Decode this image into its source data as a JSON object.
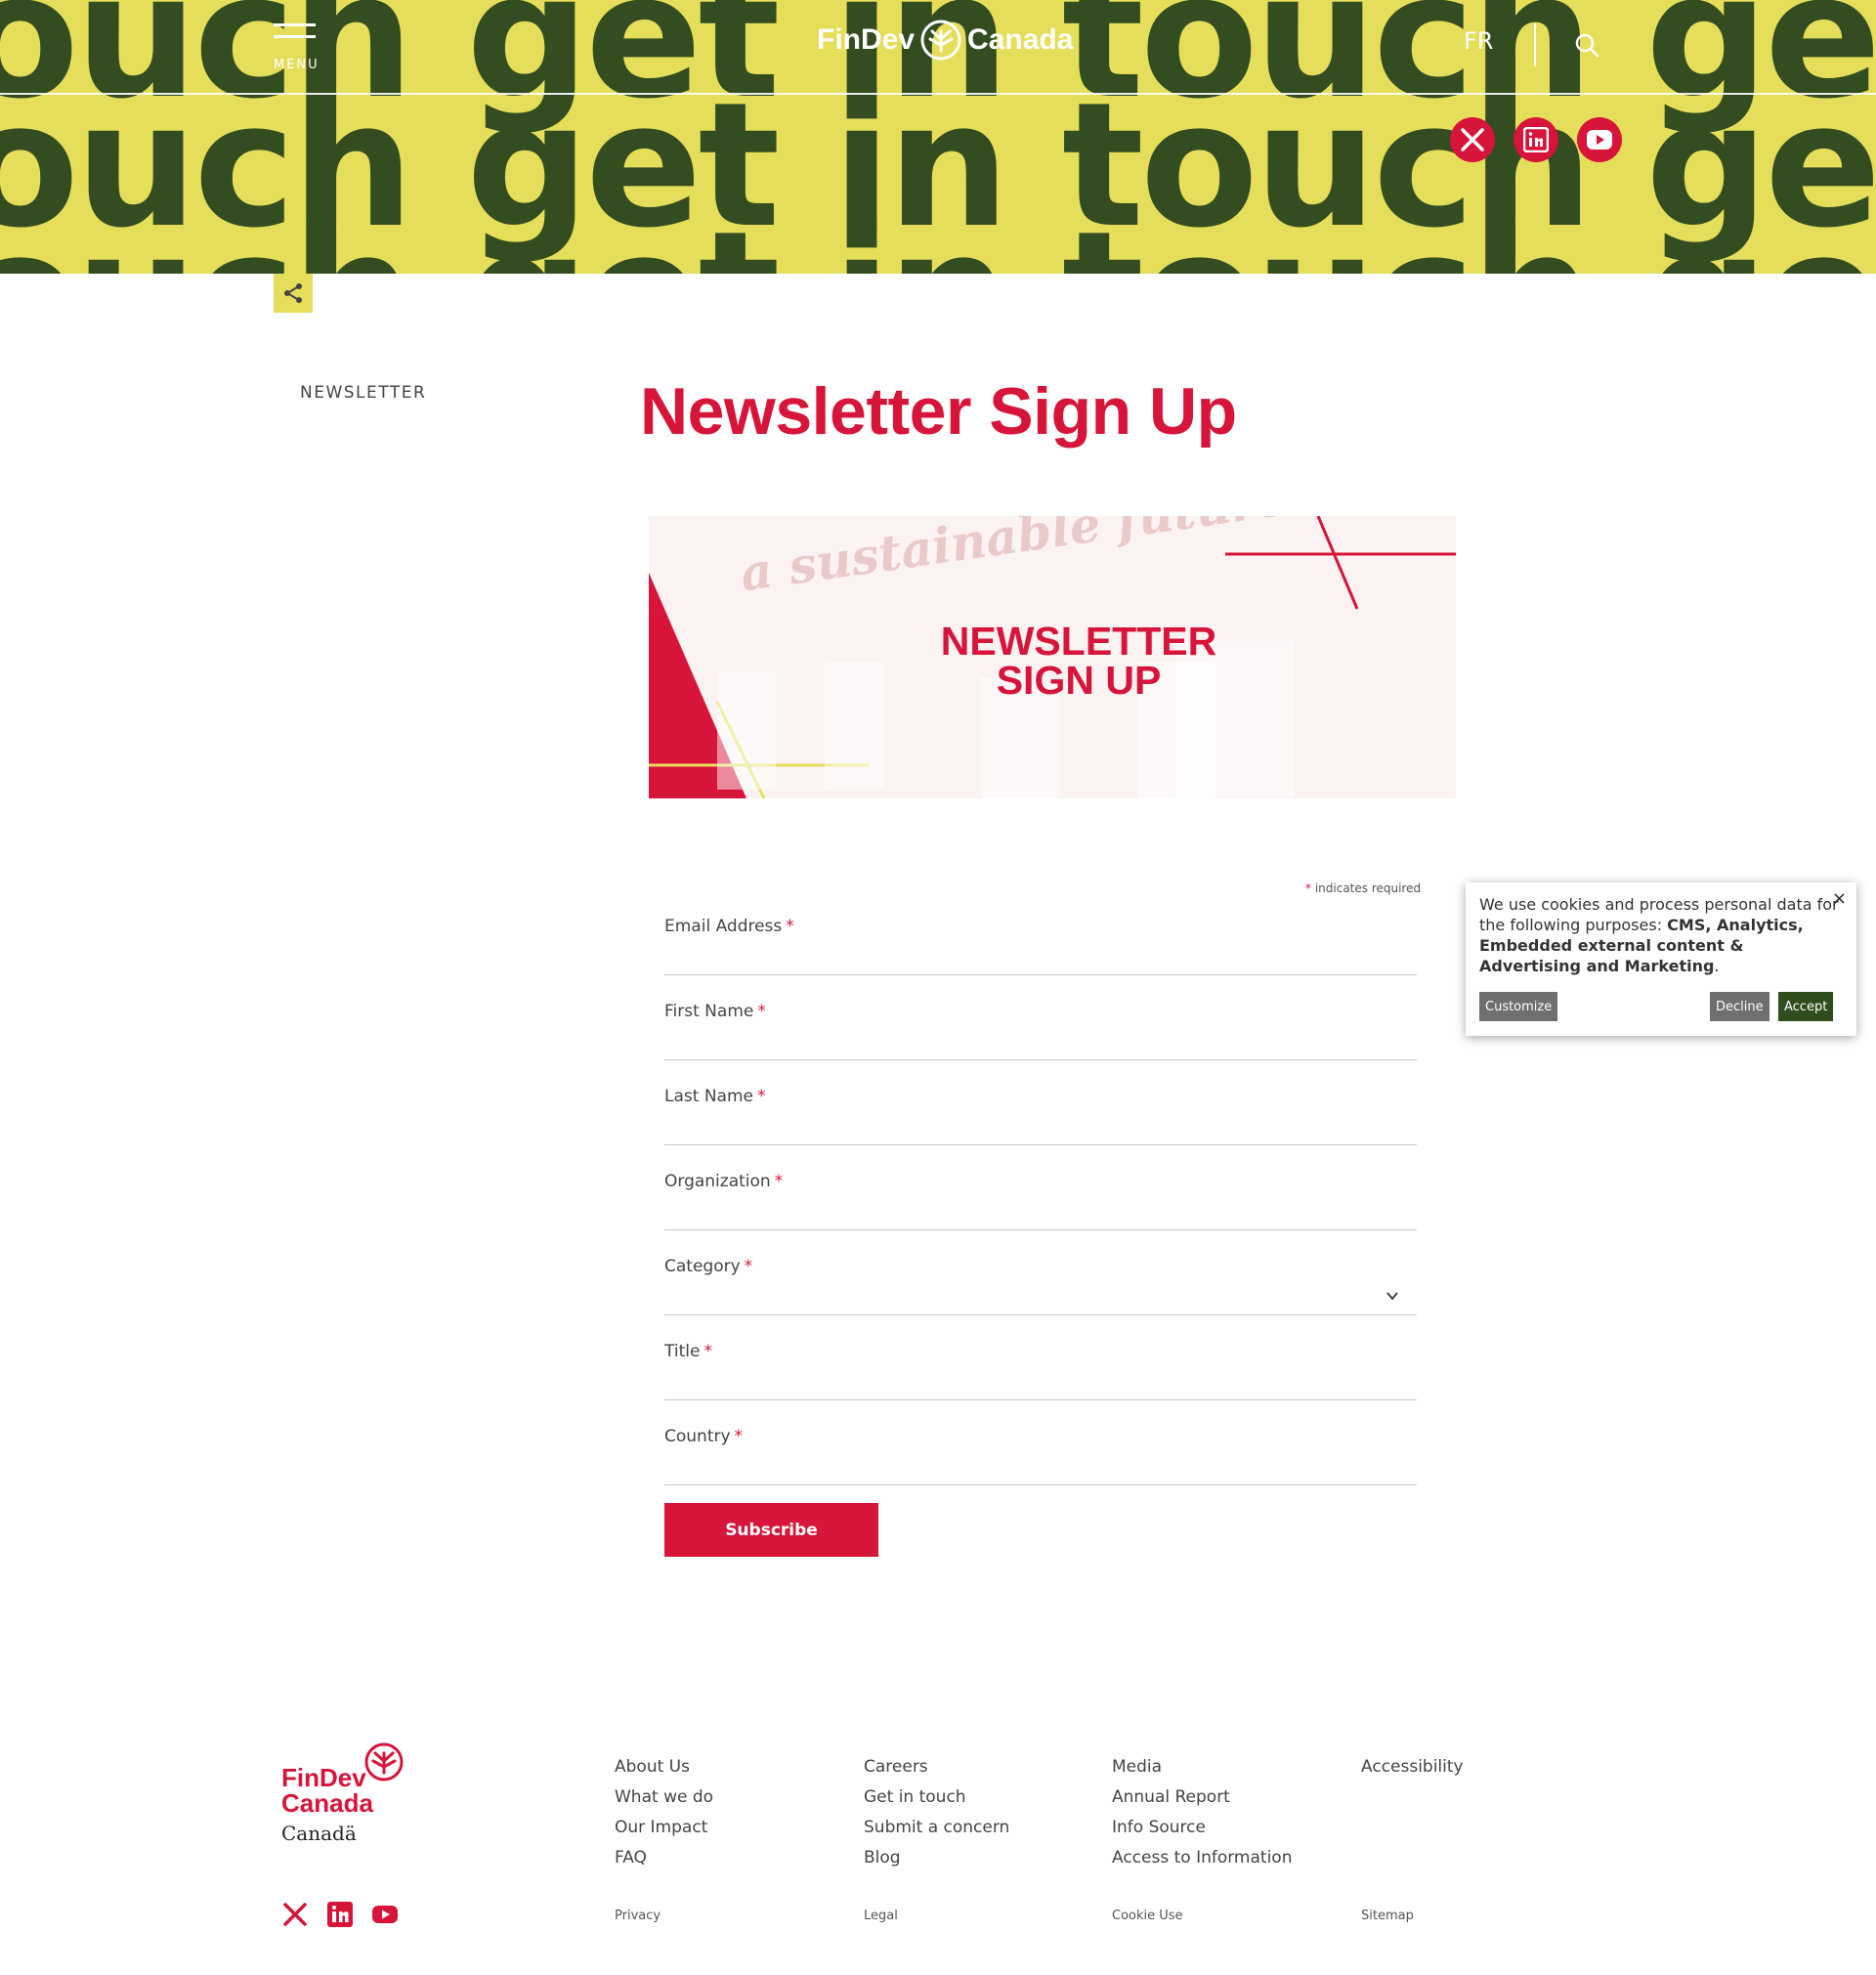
{
  "hero": {
    "pattern_text_row1": "ouch get in touch get",
    "pattern_text_row2": "ouch get in touch get",
    "pattern_text_row3": "ouch get in touch get"
  },
  "header": {
    "menu_label": "MENU",
    "logo_left": "FinDev",
    "logo_right": "Canada",
    "language": "FR"
  },
  "breadcrumb": "NEWSLETTER",
  "page_title": "Newsletter Sign Up",
  "banner": {
    "text": "NEWSLETTER SIGN UP",
    "ghost_text": "a sustainable future"
  },
  "form": {
    "required_note_star": "*",
    "required_note": "indicates required",
    "required_star": "*",
    "fields": [
      {
        "label": "Email Address",
        "value": ""
      },
      {
        "label": "First Name",
        "value": ""
      },
      {
        "label": "Last Name",
        "value": ""
      },
      {
        "label": "Organization",
        "value": ""
      },
      {
        "label": "Category",
        "value": ""
      },
      {
        "label": "Title",
        "value": ""
      },
      {
        "label": "Country",
        "value": ""
      }
    ],
    "submit_label": "Subscribe"
  },
  "cookie": {
    "text_intro": "We use cookies and process personal data for the following purposes: ",
    "text_bold": "CMS, Analytics, Embedded external content & Advertising and Marketing",
    "text_end": ".",
    "close_label": "×",
    "customize_label": "Customize",
    "decline_label": "Decline",
    "accept_label": "Accept"
  },
  "footer": {
    "col1": [
      "About Us",
      "What we do",
      "Our Impact",
      "FAQ"
    ],
    "col2": [
      "Careers",
      "Get in touch",
      "Submit a concern",
      "Blog"
    ],
    "col3": [
      "Media",
      "Annual Report",
      "Info Source",
      "Access to Information"
    ],
    "col4": [
      "Accessibility"
    ],
    "small_links": [
      "Privacy",
      "Legal",
      "Cookie Use",
      "Sitemap"
    ],
    "logo_line1": "FinDev",
    "logo_line2": "Canada",
    "wordmark": "Canadä"
  },
  "colors": {
    "accent": "#d7143a",
    "hero_bg": "#e5de5a",
    "hero_text": "#334d21",
    "accept_bg": "#2f4d1d",
    "decline_bg": "#6f6f6f"
  },
  "icons": [
    "menu-icon",
    "search-icon",
    "x-icon",
    "linkedin-icon",
    "youtube-icon",
    "share-icon",
    "close-icon",
    "chevron-down-icon"
  ]
}
